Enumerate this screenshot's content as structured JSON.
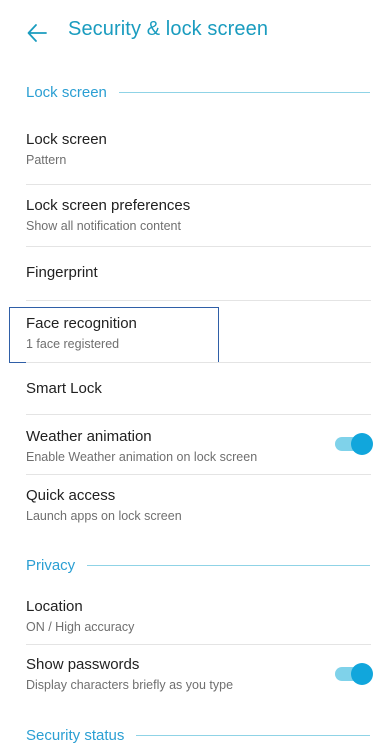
{
  "app_bar": {
    "title": "Security & lock screen",
    "back_icon": "arrow-left-icon"
  },
  "sections": {
    "lock_screen": "Lock screen",
    "privacy": "Privacy",
    "security_status": "Security status"
  },
  "items": {
    "lock_screen": {
      "title": "Lock screen",
      "sub": "Pattern"
    },
    "lock_prefs": {
      "title": "Lock screen preferences",
      "sub": "Show all notification content"
    },
    "fingerprint": {
      "title": "Fingerprint"
    },
    "face_recognition": {
      "title": "Face recognition",
      "sub": "1 face registered"
    },
    "smart_lock": {
      "title": "Smart Lock"
    },
    "weather": {
      "title": "Weather animation",
      "sub": "Enable Weather animation on lock screen",
      "enabled": true
    },
    "quick_access": {
      "title": "Quick access",
      "sub": "Launch apps on lock screen"
    },
    "location": {
      "title": "Location",
      "sub": "ON / High accuracy"
    },
    "show_passwords": {
      "title": "Show passwords",
      "sub": "Display characters briefly as you type",
      "enabled": true
    }
  },
  "colors": {
    "accent": "#1a9cbf",
    "toggle_thumb": "#11a6dc",
    "toggle_track": "#7fd2ea",
    "focus_frame": "#2f5fa7"
  }
}
